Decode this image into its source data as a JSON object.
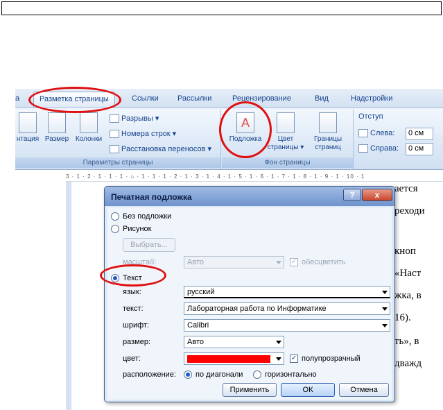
{
  "ribbon": {
    "tabs": [
      "а",
      "Разметка страницы",
      "Ссылки",
      "Рассылки",
      "Рецензирование",
      "Вид",
      "Надстройки"
    ],
    "page_setup": {
      "orientation": "нтация",
      "size": "Размер",
      "columns": "Колонки",
      "breaks": "Разрывы",
      "line_numbers": "Номера строк",
      "hyphenation": "Расстановка переносов",
      "group_label": "Параметры страницы"
    },
    "page_background": {
      "watermark": "Подложка",
      "page_color_1": "Цвет",
      "page_color_2": "страницы",
      "page_borders_1": "Границы",
      "page_borders_2": "страниц",
      "group_label": "Фон страницы"
    },
    "paragraph": {
      "indent": "Отступ",
      "left": "Слева:",
      "right": "Справа:",
      "left_value": "0 см",
      "right_value": "0 см"
    }
  },
  "ruler": "3 · 1 · 2 · 1 · 1 · 1 · ⌂ · 1 · 1 · 1 · 2 · 1 · 3 · 1 · 4 · 1 · 5 · 1 · 6 · 1 · 7 · 1 · 8 · 1 · 9 · 1 · 10 · 1",
  "document": {
    "lines": [
      "ается",
      "реходи",
      "кноп",
      "«Наст",
      "жка, в",
      "16).",
      "ть»,  в",
      "дважд"
    ]
  },
  "dialog": {
    "title": "Печатная подложка",
    "help": "?",
    "close": "x",
    "no_watermark": "Без подложки",
    "picture": "Рисунок",
    "select_button": "Выбрать...",
    "scale_label": "масштаб:",
    "scale_value": "Авто",
    "washout": "обесцветить",
    "text_option": "Текст",
    "language_label": "язык:",
    "language_value": "русский",
    "text_label": "текст:",
    "text_value": "Лабораторная работа по Информатике",
    "font_label": "шрифт:",
    "font_value": "Calibri",
    "size_label": "размер:",
    "size_value": "Авто",
    "color_label": "цвет:",
    "color_value": "#ff0000",
    "semitransparent": "полупрозрачный",
    "layout_label": "расположение:",
    "diagonal": "по диагонали",
    "horizontal": "горизонтально",
    "apply": "Применить",
    "ok": "ОК",
    "cancel": "Отмена"
  }
}
